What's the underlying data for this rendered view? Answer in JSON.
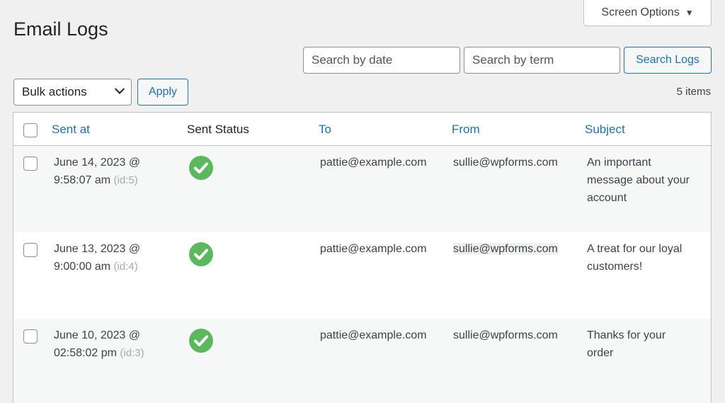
{
  "header": {
    "screen_options_label": "Screen Options",
    "page_title": "Email Logs"
  },
  "search": {
    "date_placeholder": "Search by date",
    "term_placeholder": "Search by term",
    "button_label": "Search Logs"
  },
  "bulk": {
    "selected": "Bulk actions",
    "apply_label": "Apply"
  },
  "items_count": "5 items",
  "table": {
    "columns": [
      "Sent at",
      "Sent Status",
      "To",
      "From",
      "Subject"
    ],
    "rows": [
      {
        "sent_at_line1": "June 14, 2023 @",
        "sent_at_line2": "9:58:07 am",
        "id": "(id:5)",
        "status": "success",
        "to": "pattie@example.com",
        "from": "sullie@wpforms.com",
        "subject": [
          "An important",
          "message about your",
          "account"
        ]
      },
      {
        "sent_at_line1": "June 13, 2023 @",
        "sent_at_line2": "9:00:00 am",
        "id": "(id:4)",
        "status": "success",
        "to": "pattie@example.com",
        "from": "sullie@wpforms.com",
        "subject": [
          "A treat for our loyal",
          "customers!"
        ]
      },
      {
        "sent_at_line1": "June 10, 2023 @",
        "sent_at_line2": "02:58:02 pm",
        "id": "(id:3)",
        "status": "success",
        "to": "pattie@example.com",
        "from": "sullie@wpforms.com",
        "subject": [
          "Thanks for your",
          "order"
        ]
      }
    ]
  },
  "colors": {
    "link": "#2271b1",
    "success": "#5cb85c"
  }
}
